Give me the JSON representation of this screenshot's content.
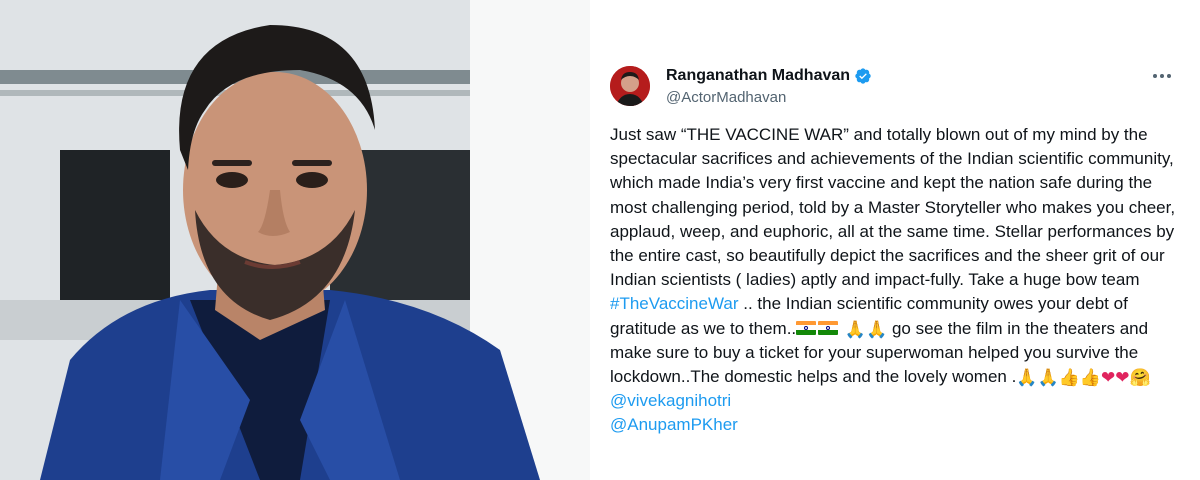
{
  "tweet": {
    "author": {
      "display_name": "Ranganathan Madhavan",
      "handle": "@ActorMadhavan",
      "verified": true
    },
    "text_part1": "Just saw “THE VACCINE WAR” and totally blown out of my mind by the spectacular sacrifices and achievements of the Indian scientific community, which made  India’s  very first vaccine and kept the nation safe during the most challenging period, told by a Master Storyteller who makes you cheer, applaud, weep, and euphoric, all at the same time. Stellar performances by the entire cast, so beautifully depict the sacrifices and the sheer grit of our Indian scientists ( ladies) aptly and impact-fully. Take a huge bow team ",
    "hashtag": "#TheVaccineWar",
    "text_part2": " .. the Indian scientific community owes your debt of gratitude as we to them..",
    "text_part3": " go see the film in the theaters and make sure to buy a ticket for your superwoman  helped you survive the lockdown..The domestic helps and the lovely women .",
    "mention1": "@vivekagnihotri",
    "mention2": "@AnupamPKher",
    "emoji": {
      "pray": "🙏",
      "thumbs_up": "👍",
      "heart": "❤",
      "hug": "🤗"
    }
  },
  "colors": {
    "link": "#1d9bf0",
    "text": "#0f1419",
    "secondary": "#536471",
    "verified": "#1d9bf0"
  },
  "icons": [
    "verified-badge-icon",
    "more-options-icon",
    "india-flag-icon"
  ]
}
